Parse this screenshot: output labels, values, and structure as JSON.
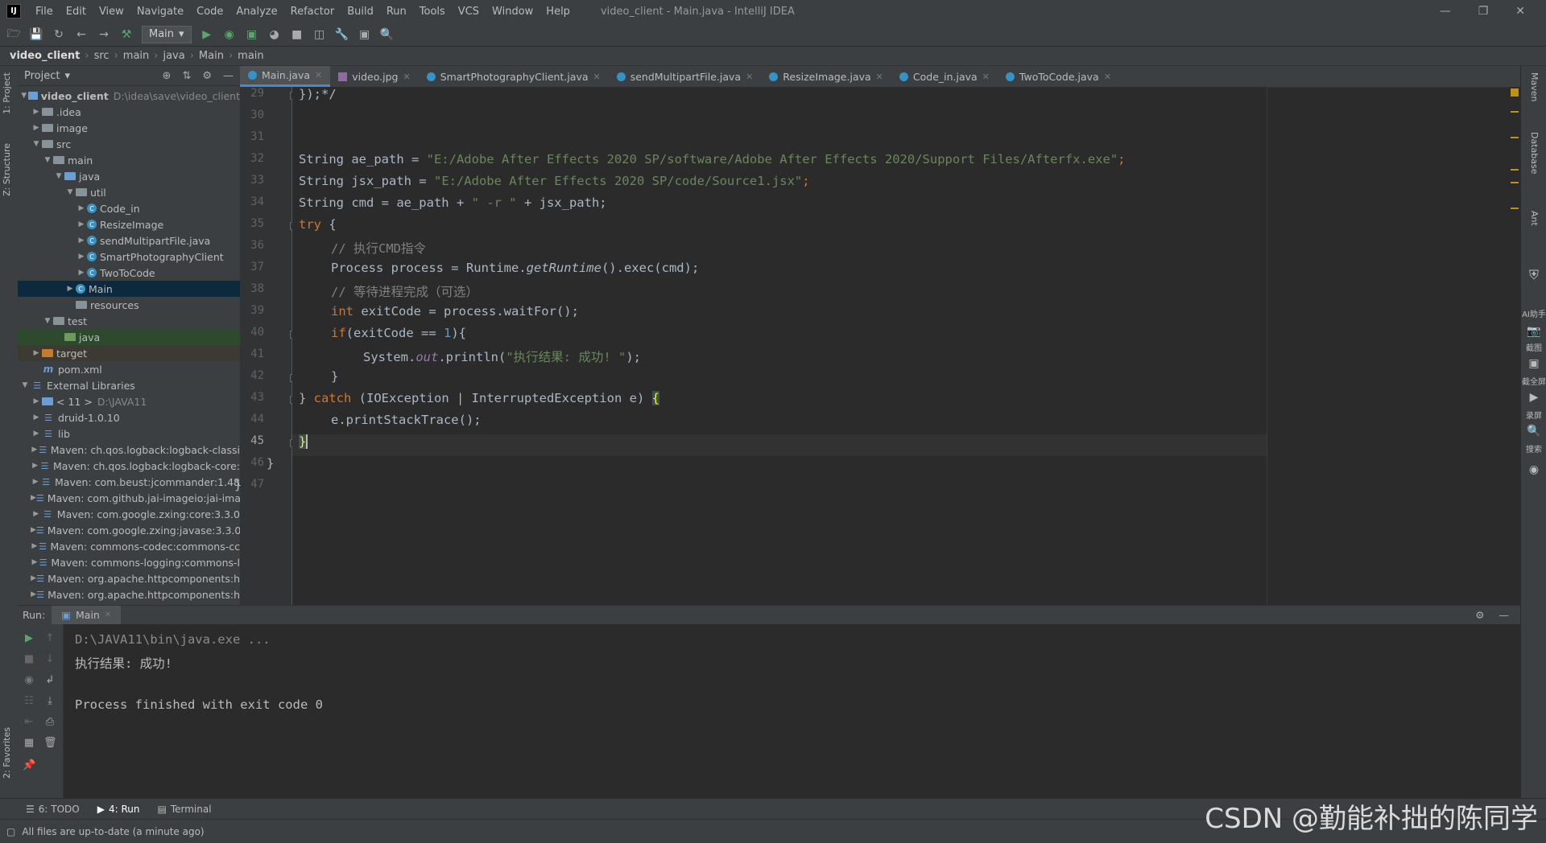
{
  "window": {
    "logo": "IJ",
    "menu": [
      "File",
      "Edit",
      "View",
      "Navigate",
      "Code",
      "Analyze",
      "Refactor",
      "Build",
      "Run",
      "Tools",
      "VCS",
      "Window",
      "Help"
    ],
    "title": "video_client - Main.java - IntelliJ IDEA",
    "controls": [
      "—",
      "❐",
      "✕"
    ]
  },
  "toolbar": {
    "run_config": "Main"
  },
  "breadcrumb": [
    "video_client",
    "src",
    "main",
    "java",
    "Main",
    "main"
  ],
  "left_stripe": {
    "project_tab": "1: Project",
    "structure_tab": "Z: Structure",
    "favorites_tab": "2: Favorites"
  },
  "project": {
    "title": "Project",
    "root": {
      "label": "video_client",
      "path": "D:\\idea\\save\\video_client"
    },
    "items": [
      {
        "label": ".idea"
      },
      {
        "label": "image"
      },
      {
        "label": "src"
      },
      {
        "label": "main"
      },
      {
        "label": "java"
      },
      {
        "label": "util"
      },
      {
        "label": "Code_in"
      },
      {
        "label": "ResizeImage"
      },
      {
        "label": "sendMultipartFile.java"
      },
      {
        "label": "SmartPhotographyClient"
      },
      {
        "label": "TwoToCode"
      },
      {
        "label": "Main"
      },
      {
        "label": "resources"
      },
      {
        "label": "test"
      },
      {
        "label": "java"
      },
      {
        "label": "target"
      },
      {
        "label": "pom.xml"
      },
      {
        "label": "External Libraries"
      },
      {
        "label": "< 11 >",
        "hint": "D:\\JAVA11"
      },
      {
        "label": "druid-1.0.10"
      },
      {
        "label": "lib"
      },
      {
        "label": "Maven: ch.qos.logback:logback-classi"
      },
      {
        "label": "Maven: ch.qos.logback:logback-core:"
      },
      {
        "label": "Maven: com.beust:jcommander:1.48"
      },
      {
        "label": "Maven: com.github.jai-imageio:jai-ima"
      },
      {
        "label": "Maven: com.google.zxing:core:3.3.0"
      },
      {
        "label": "Maven: com.google.zxing:javase:3.3.0"
      },
      {
        "label": "Maven: commons-codec:commons-cc"
      },
      {
        "label": "Maven: commons-logging:commons-l"
      },
      {
        "label": "Maven: org.apache.httpcomponents:h"
      },
      {
        "label": "Maven: org.apache.httpcomponents:h"
      }
    ]
  },
  "tabs": [
    "Main.java",
    "video.jpg",
    "SmartPhotographyClient.java",
    "sendMultipartFile.java",
    "ResizeImage.java",
    "Code_in.java",
    "TwoToCode.java"
  ],
  "editor": {
    "line_numbers": [
      "29",
      "30",
      "31",
      "32",
      "33",
      "34",
      "35",
      "36",
      "37",
      "38",
      "39",
      "40",
      "41",
      "42",
      "43",
      "44",
      "45",
      "46",
      "47"
    ],
    "code": {
      "l29": "});*/",
      "l32a": "String ae_path = ",
      "l32b": "\"E:/Adobe After Effects 2020 SP/software/Adobe After Effects 2020/Support Files/Afterfx.exe\"",
      "l32c": ";",
      "l33a": "String jsx_path = ",
      "l33b": "\"E:/Adobe After Effects 2020 SP/code/Source1.jsx\"",
      "l33c": ";",
      "l34a": "String cmd = ae_path + ",
      "l34b": "\" -r \"",
      "l34c": " + jsx_path;",
      "l35a": "try",
      "l35b": " {",
      "l36": "// 执行CMD指令",
      "l37a": "Process process = Runtime.",
      "l37b": "getRuntime",
      "l37c": "().exec(cmd);",
      "l38": "// 等待进程完成（可选）",
      "l39a": "int",
      "l39b": " exitCode = process.waitFor();",
      "l40a": "if",
      "l40b": "(exitCode == ",
      "l40c": "1",
      "l40d": "){",
      "l41a": "System.",
      "l41b": "out",
      "l41c": ".println(",
      "l41d": "\"执行结果: 成功! \"",
      "l41e": ");",
      "l42": "}",
      "l43a": "} ",
      "l43b": "catch",
      "l43c": " (IOException | InterruptedException e) ",
      "l43d": "{",
      "l44": "e.printStackTrace();",
      "l45": "}",
      "l46": "}",
      "l47": "}"
    }
  },
  "right_stripe": [
    "Maven",
    "Database",
    "Ant",
    "AI助手",
    "截图",
    "截全屏",
    "录屏",
    "搜索"
  ],
  "run": {
    "label": "Run:",
    "tab": "Main",
    "console": [
      "D:\\JAVA11\\bin\\java.exe ...",
      "执行结果: 成功!",
      "",
      "Process finished with exit code 0"
    ]
  },
  "bottom_tools": [
    {
      "icon": "☰",
      "label": "6: TODO"
    },
    {
      "icon": "▶",
      "label": "4: Run"
    },
    {
      "icon": "▤",
      "label": "Terminal"
    }
  ],
  "status": {
    "message": "All files are up-to-date (a minute ago)"
  },
  "watermark": "CSDN @勤能补拙的陈同学"
}
